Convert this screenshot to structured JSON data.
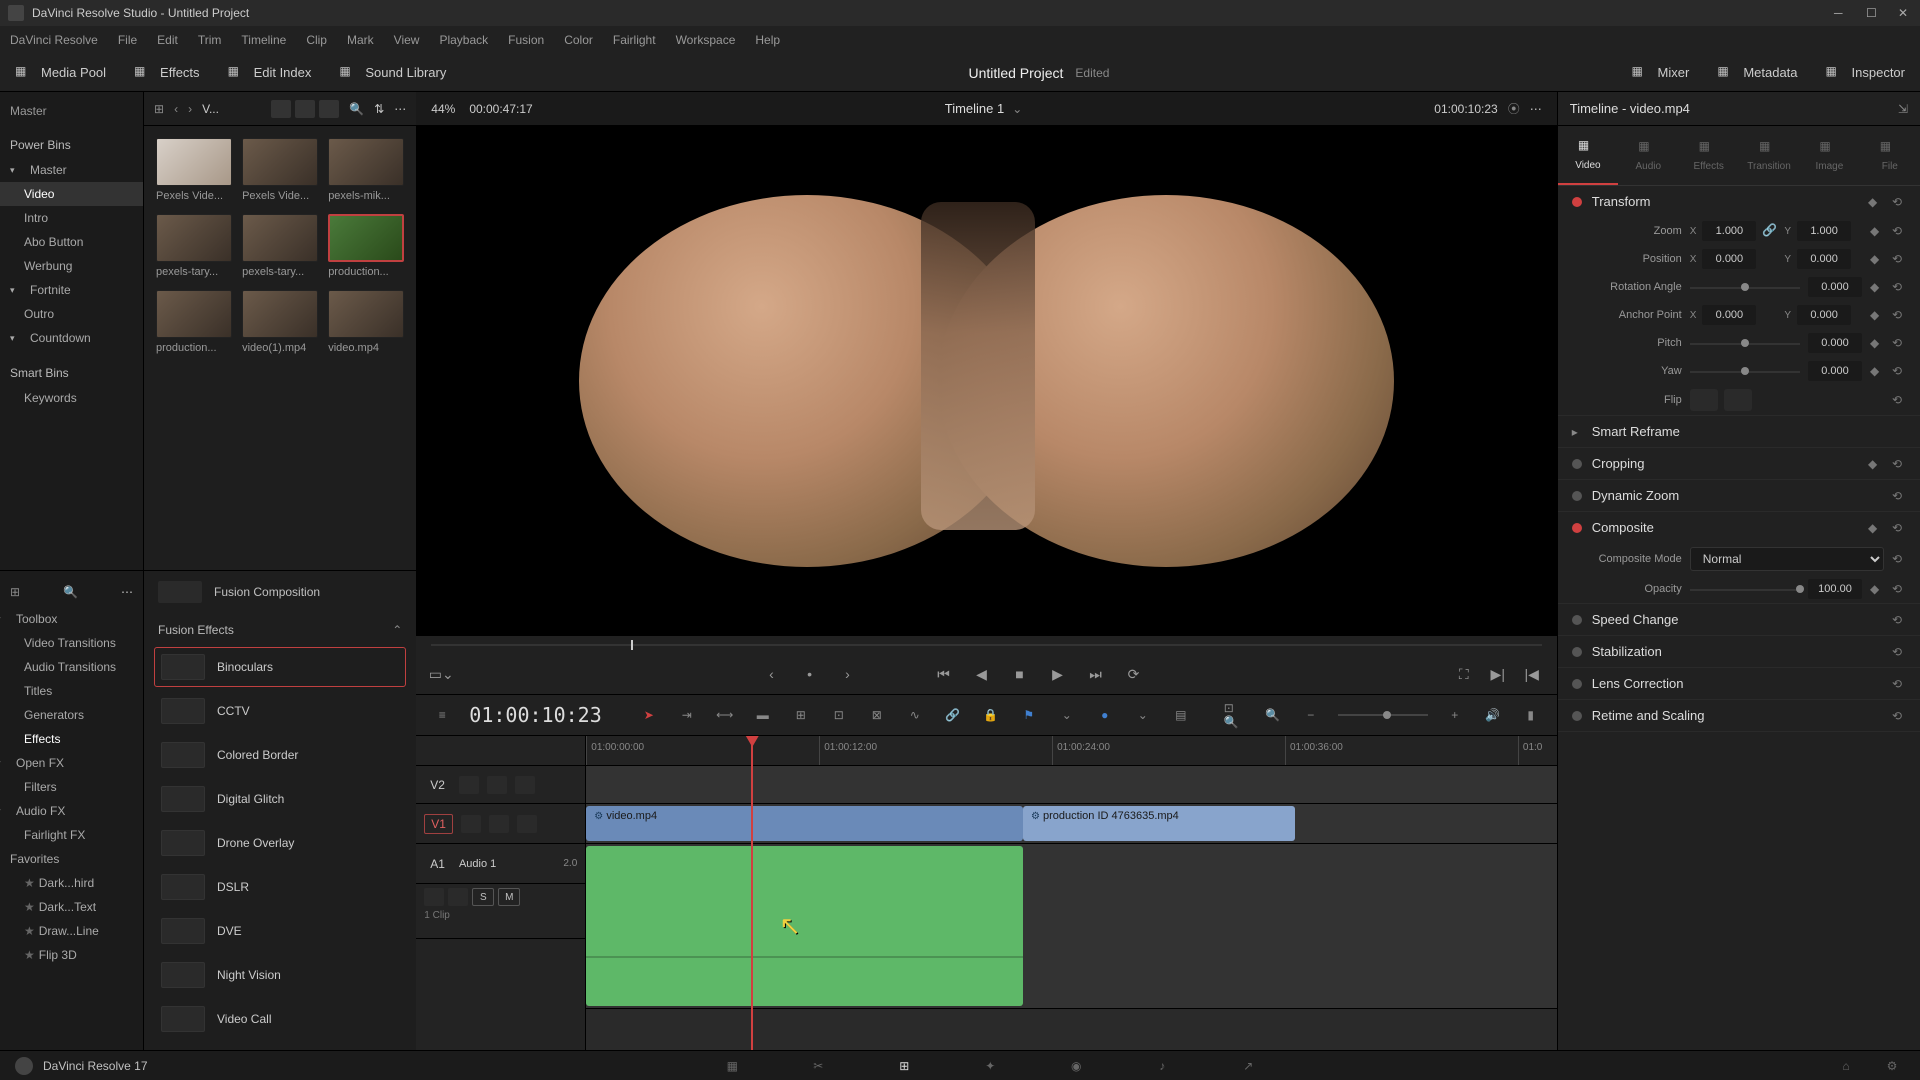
{
  "titlebar": {
    "text": "DaVinci Resolve Studio - Untitled Project"
  },
  "menubar": [
    "DaVinci Resolve",
    "File",
    "Edit",
    "Trim",
    "Timeline",
    "Clip",
    "Mark",
    "View",
    "Playback",
    "Fusion",
    "Color",
    "Fairlight",
    "Workspace",
    "Help"
  ],
  "toolbar": {
    "left": [
      {
        "name": "media-pool-button",
        "label": "Media Pool"
      },
      {
        "name": "effects-button",
        "label": "Effects"
      },
      {
        "name": "edit-index-button",
        "label": "Edit Index"
      },
      {
        "name": "sound-library-button",
        "label": "Sound Library"
      }
    ],
    "project_title": "Untitled Project",
    "edited": "Edited",
    "right": [
      {
        "name": "mixer-button",
        "label": "Mixer"
      },
      {
        "name": "metadata-button",
        "label": "Metadata"
      },
      {
        "name": "inspector-button",
        "label": "Inspector"
      }
    ]
  },
  "media_tree": {
    "master": "Master",
    "power_bins": "Power Bins",
    "items": [
      {
        "label": "Master",
        "expand": true
      },
      {
        "label": "Video",
        "active": true
      },
      {
        "label": "Intro"
      },
      {
        "label": "Abo Button"
      },
      {
        "label": "Werbung"
      },
      {
        "label": "Fortnite",
        "expand": true
      },
      {
        "label": "Outro"
      },
      {
        "label": "Countdown",
        "expand": true
      }
    ],
    "smart_bins": "Smart Bins",
    "keywords": "Keywords"
  },
  "media_header": {
    "path_label": "V...",
    "zoom": "44%",
    "tc": "00:00:47:17"
  },
  "media_clips": [
    {
      "name": "Pexels Vide...",
      "style": "light"
    },
    {
      "name": "Pexels Vide...",
      "style": ""
    },
    {
      "name": "pexels-mik...",
      "style": ""
    },
    {
      "name": "pexels-tary...",
      "style": ""
    },
    {
      "name": "pexels-tary...",
      "style": ""
    },
    {
      "name": "production...",
      "style": "green"
    },
    {
      "name": "production...",
      "style": ""
    },
    {
      "name": "video(1).mp4",
      "style": ""
    },
    {
      "name": "video.mp4",
      "style": ""
    }
  ],
  "effects_tree": {
    "toolbox": "Toolbox",
    "items": [
      "Video Transitions",
      "Audio Transitions",
      "Titles",
      "Generators",
      "Effects"
    ],
    "openfx": "Open FX",
    "filters": "Filters",
    "audiofx": "Audio FX",
    "fairlight": "Fairlight FX",
    "favorites": "Favorites",
    "fav_items": [
      "Dark...hird",
      "Dark...Text",
      "Draw...Line",
      "Flip 3D"
    ]
  },
  "fusion_comp": "Fusion Composition",
  "fusion_effects_header": "Fusion Effects",
  "fusion_effects": [
    "Binoculars",
    "CCTV",
    "Colored Border",
    "Digital Glitch",
    "Drone Overlay",
    "DSLR",
    "DVE",
    "Night Vision",
    "Video Call"
  ],
  "viewer": {
    "timeline_name": "Timeline 1",
    "tc": "01:00:10:23"
  },
  "timeline_tools": {
    "timecode": "01:00:10:23"
  },
  "ruler_ticks": [
    "01:00:00:00",
    "01:00:12:00",
    "01:00:24:00",
    "01:00:36:00",
    "01:0"
  ],
  "tracks": {
    "v2": "V2",
    "v1": "V1",
    "a1": "A1",
    "a1_name": "Audio 1",
    "a1_level": "2.0",
    "s": "S",
    "m": "M",
    "clips_info": "1 Clip"
  },
  "clips": {
    "video1": {
      "name": "video.mp4"
    },
    "video2": {
      "name": "production ID 4763635.mp4"
    }
  },
  "inspector": {
    "title": "Timeline - video.mp4",
    "tabs": [
      "Video",
      "Audio",
      "Effects",
      "Transition",
      "Image",
      "File"
    ],
    "transform": {
      "title": "Transform",
      "zoom": "Zoom",
      "zoom_x": "1.000",
      "zoom_y": "1.000",
      "position": "Position",
      "pos_x": "0.000",
      "pos_y": "0.000",
      "rotation": "Rotation Angle",
      "rot_val": "0.000",
      "anchor": "Anchor Point",
      "anc_x": "0.000",
      "anc_y": "0.000",
      "pitch": "Pitch",
      "pitch_val": "0.000",
      "yaw": "Yaw",
      "yaw_val": "0.000",
      "flip": "Flip",
      "x": "X",
      "y": "Y"
    },
    "sections": [
      "Smart Reframe",
      "Cropping",
      "Dynamic Zoom",
      "Composite",
      "Speed Change",
      "Stabilization",
      "Lens Correction",
      "Retime and Scaling"
    ],
    "composite_mode_label": "Composite Mode",
    "composite_mode": "Normal",
    "opacity_label": "Opacity",
    "opacity": "100.00"
  },
  "bottom": {
    "version": "DaVinci Resolve 17"
  }
}
